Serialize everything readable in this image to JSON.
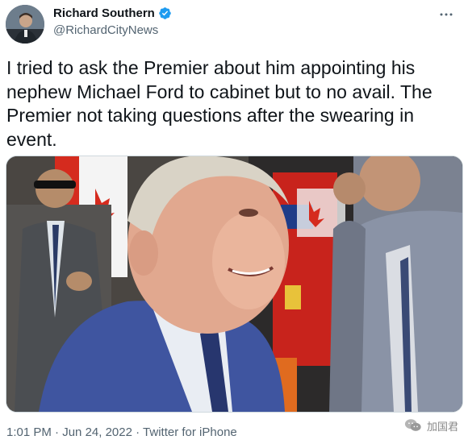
{
  "author": {
    "name": "Richard Southern",
    "handle": "@RichardCityNews",
    "verified_icon": "verified-badge-icon",
    "avatar_icon": "avatar-photo"
  },
  "tweet": {
    "text": "I tried to ask the Premier about him appointing his\nnephew Michael Ford to cabinet but to no avail. The\nPremier not taking questions after the swearing in\nevent."
  },
  "media": {
    "description_icon": "photo-premier-at-event"
  },
  "footer": {
    "time": "1:01 PM",
    "separator1": " · ",
    "date": "Jun 24, 2022",
    "separator2": " · ",
    "source": "Twitter for iPhone"
  },
  "watermark": {
    "text": "加国君",
    "icon": "wechat-logo-icon"
  },
  "colors": {
    "text": "#0f1419",
    "secondary": "#536471",
    "verified": "#1d9bf0",
    "border": "#cfd9de"
  }
}
